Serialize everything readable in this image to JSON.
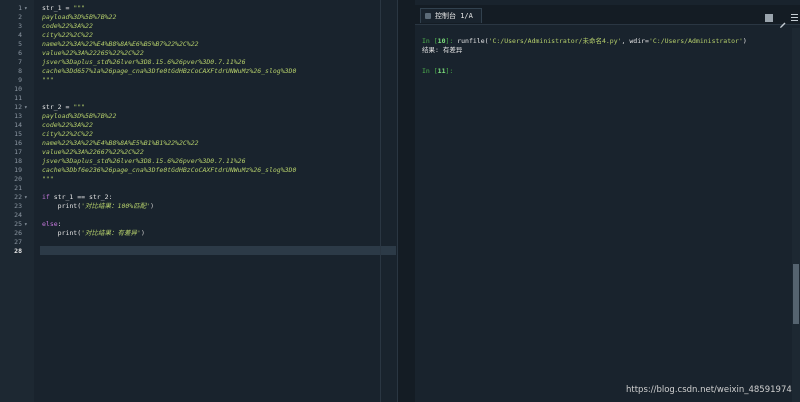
{
  "editor": {
    "line_numbers": [
      "1",
      "2",
      "3",
      "4",
      "5",
      "6",
      "7",
      "8",
      "9",
      "10",
      "11",
      "12",
      "13",
      "14",
      "15",
      "16",
      "17",
      "18",
      "19",
      "20",
      "21",
      "22",
      "23",
      "24",
      "25",
      "26",
      "27",
      "28"
    ],
    "current_line": "28",
    "lines": {
      "l1_var": "str_1",
      "l1_op": " = ",
      "l1_str": "\"\"\"",
      "l2": "payload%3D%5B%7B%22",
      "l3": "code%22%3A%22",
      "l4": "city%22%2C%22",
      "l5": "name%22%3A%22%E4%B8%8A%E6%B5%B7%22%2C%22",
      "l6": "value%22%3A%22265%22%2C%22",
      "l7": "jsver%3Daplus_std%26lver%3D8.15.6%26pver%3D0.7.11%26",
      "l8": "cache%3Dd657%1a%26page_cna%3Dfe0tGdHBzCoCAXFtdrUNWuMz%26_slog%3D0",
      "l9": "\"\"\"",
      "l12_var": "str_2",
      "l12_op": " = ",
      "l12_str": "\"\"\"",
      "l13": "payload%3D%5B%7B%22",
      "l14": "code%22%3A%22",
      "l15": "city%22%2C%22",
      "l16": "name%22%3A%22%E4%B8%8A%E5%B1%B1%22%2C%22",
      "l17": "value%22%3A%22667%22%2C%22",
      "l18": "jsver%3Daplus_std%26lver%3D8.15.6%26pver%3D0.7.11%26",
      "l19": "cache%3Dbf6e236%26page_cna%3Dfe0tGdHBzCoCAXFtdrUNWuMz%26_slog%3D0",
      "l20": "\"\"\"",
      "l22_kw": "if",
      "l22_rest": " str_1 == str_2:",
      "l23_fn": "    print(",
      "l23_str": "'对比结果：100%匹配'",
      "l23_close": ")",
      "l25_kw": "else",
      "l25_rest": ":",
      "l26_fn": "    print(",
      "l26_str": "'对比结果：有差异'",
      "l26_close": ")"
    }
  },
  "console": {
    "tab_label": "控制台 1/A",
    "in10_prefix": "In [",
    "in10_num": "10",
    "in10_suffix": "]: ",
    "in10_cmd": "runfile(",
    "in10_arg1": "'C:/Users/Administrator/未命名4.py'",
    "in10_mid": ", wdir=",
    "in10_arg2": "'C:/Users/Administrator'",
    "in10_close": ")",
    "output": "结果: 有差异",
    "in11_prefix": "In [",
    "in11_num": "11",
    "in11_suffix": "]:"
  },
  "watermark": "https://blog.csdn.net/weixin_48591974",
  "colors": {
    "background": "#19232d",
    "string": "#b5cf6b",
    "keyword": "#c678dd",
    "prompt": "#4db34d"
  },
  "icons": {
    "stop": "square-stop-icon",
    "edit": "pencil-icon",
    "menu": "hamburger-menu-icon"
  }
}
